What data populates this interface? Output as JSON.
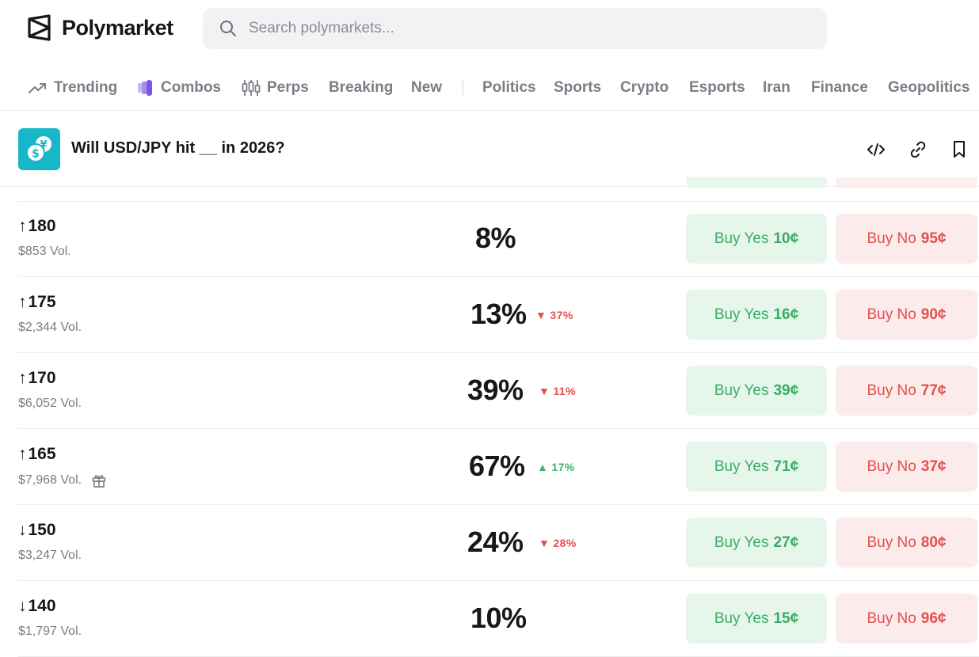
{
  "brand": {
    "name": "Polymarket"
  },
  "search": {
    "placeholder": "Search polymarkets..."
  },
  "nav": {
    "items": [
      {
        "label": "Trending",
        "icon": "trending-icon"
      },
      {
        "label": "Combos",
        "icon": "combos-icon"
      },
      {
        "label": "Perps",
        "icon": "perps-icon"
      },
      {
        "label": "Breaking"
      },
      {
        "label": "New"
      },
      {
        "label": "Politics"
      },
      {
        "label": "Sports"
      },
      {
        "label": "Crypto"
      },
      {
        "label": "Esports"
      },
      {
        "label": "Iran"
      },
      {
        "label": "Finance"
      },
      {
        "label": "Geopolitics"
      }
    ]
  },
  "market": {
    "title": "Will USD/JPY hit __ in 2026?",
    "icon": "usd-yen-coins-icon",
    "actions": [
      "embed-icon",
      "link-icon",
      "bookmark-icon"
    ]
  },
  "colors": {
    "yes_text": "#3aac66",
    "yes_bg": "#e6f6ea",
    "no_text": "#e2514c",
    "no_bg": "#fcebeb",
    "accent_icon": "#17b6c8"
  },
  "rows": [
    {
      "arrow": "↑",
      "value": "180",
      "volume": "$853 Vol.",
      "pct": "8%",
      "delta": "",
      "delta_dir": "",
      "yes_label": "Buy Yes",
      "yes_price": "10¢",
      "no_label": "Buy No",
      "no_price": "95¢",
      "gift": false
    },
    {
      "arrow": "↑",
      "value": "175",
      "volume": "$2,344 Vol.",
      "pct": "13%",
      "delta": "37%",
      "delta_dir": "down",
      "yes_label": "Buy Yes",
      "yes_price": "16¢",
      "no_label": "Buy No",
      "no_price": "90¢",
      "gift": false
    },
    {
      "arrow": "↑",
      "value": "170",
      "volume": "$6,052 Vol.",
      "pct": "39%",
      "delta": "11%",
      "delta_dir": "down",
      "yes_label": "Buy Yes",
      "yes_price": "39¢",
      "no_label": "Buy No",
      "no_price": "77¢",
      "gift": false
    },
    {
      "arrow": "↑",
      "value": "165",
      "volume": "$7,968 Vol.",
      "pct": "67%",
      "delta": "17%",
      "delta_dir": "up",
      "yes_label": "Buy Yes",
      "yes_price": "71¢",
      "no_label": "Buy No",
      "no_price": "37¢",
      "gift": true
    },
    {
      "arrow": "↓",
      "value": "150",
      "volume": "$3,247 Vol.",
      "pct": "24%",
      "delta": "28%",
      "delta_dir": "down",
      "yes_label": "Buy Yes",
      "yes_price": "27¢",
      "no_label": "Buy No",
      "no_price": "80¢",
      "gift": false
    },
    {
      "arrow": "↓",
      "value": "140",
      "volume": "$1,797 Vol.",
      "pct": "10%",
      "delta": "",
      "delta_dir": "",
      "yes_label": "Buy Yes",
      "yes_price": "15¢",
      "no_label": "Buy No",
      "no_price": "96¢",
      "gift": false
    }
  ]
}
